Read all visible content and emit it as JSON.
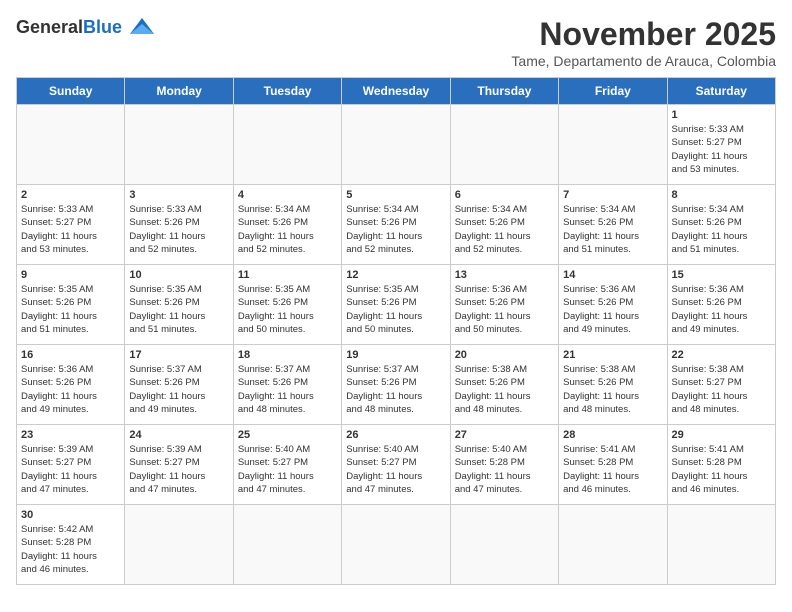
{
  "header": {
    "logo_general": "General",
    "logo_blue": "Blue",
    "month_title": "November 2025",
    "location": "Tame, Departamento de Arauca, Colombia"
  },
  "days_of_week": [
    "Sunday",
    "Monday",
    "Tuesday",
    "Wednesday",
    "Thursday",
    "Friday",
    "Saturday"
  ],
  "weeks": [
    [
      {
        "day": "",
        "info": ""
      },
      {
        "day": "",
        "info": ""
      },
      {
        "day": "",
        "info": ""
      },
      {
        "day": "",
        "info": ""
      },
      {
        "day": "",
        "info": ""
      },
      {
        "day": "",
        "info": ""
      },
      {
        "day": "1",
        "info": "Sunrise: 5:33 AM\nSunset: 5:27 PM\nDaylight: 11 hours\nand 53 minutes."
      }
    ],
    [
      {
        "day": "2",
        "info": "Sunrise: 5:33 AM\nSunset: 5:27 PM\nDaylight: 11 hours\nand 53 minutes."
      },
      {
        "day": "3",
        "info": "Sunrise: 5:33 AM\nSunset: 5:26 PM\nDaylight: 11 hours\nand 52 minutes."
      },
      {
        "day": "4",
        "info": "Sunrise: 5:34 AM\nSunset: 5:26 PM\nDaylight: 11 hours\nand 52 minutes."
      },
      {
        "day": "5",
        "info": "Sunrise: 5:34 AM\nSunset: 5:26 PM\nDaylight: 11 hours\nand 52 minutes."
      },
      {
        "day": "6",
        "info": "Sunrise: 5:34 AM\nSunset: 5:26 PM\nDaylight: 11 hours\nand 52 minutes."
      },
      {
        "day": "7",
        "info": "Sunrise: 5:34 AM\nSunset: 5:26 PM\nDaylight: 11 hours\nand 51 minutes."
      },
      {
        "day": "8",
        "info": "Sunrise: 5:34 AM\nSunset: 5:26 PM\nDaylight: 11 hours\nand 51 minutes."
      }
    ],
    [
      {
        "day": "9",
        "info": "Sunrise: 5:35 AM\nSunset: 5:26 PM\nDaylight: 11 hours\nand 51 minutes."
      },
      {
        "day": "10",
        "info": "Sunrise: 5:35 AM\nSunset: 5:26 PM\nDaylight: 11 hours\nand 51 minutes."
      },
      {
        "day": "11",
        "info": "Sunrise: 5:35 AM\nSunset: 5:26 PM\nDaylight: 11 hours\nand 50 minutes."
      },
      {
        "day": "12",
        "info": "Sunrise: 5:35 AM\nSunset: 5:26 PM\nDaylight: 11 hours\nand 50 minutes."
      },
      {
        "day": "13",
        "info": "Sunrise: 5:36 AM\nSunset: 5:26 PM\nDaylight: 11 hours\nand 50 minutes."
      },
      {
        "day": "14",
        "info": "Sunrise: 5:36 AM\nSunset: 5:26 PM\nDaylight: 11 hours\nand 49 minutes."
      },
      {
        "day": "15",
        "info": "Sunrise: 5:36 AM\nSunset: 5:26 PM\nDaylight: 11 hours\nand 49 minutes."
      }
    ],
    [
      {
        "day": "16",
        "info": "Sunrise: 5:36 AM\nSunset: 5:26 PM\nDaylight: 11 hours\nand 49 minutes."
      },
      {
        "day": "17",
        "info": "Sunrise: 5:37 AM\nSunset: 5:26 PM\nDaylight: 11 hours\nand 49 minutes."
      },
      {
        "day": "18",
        "info": "Sunrise: 5:37 AM\nSunset: 5:26 PM\nDaylight: 11 hours\nand 48 minutes."
      },
      {
        "day": "19",
        "info": "Sunrise: 5:37 AM\nSunset: 5:26 PM\nDaylight: 11 hours\nand 48 minutes."
      },
      {
        "day": "20",
        "info": "Sunrise: 5:38 AM\nSunset: 5:26 PM\nDaylight: 11 hours\nand 48 minutes."
      },
      {
        "day": "21",
        "info": "Sunrise: 5:38 AM\nSunset: 5:26 PM\nDaylight: 11 hours\nand 48 minutes."
      },
      {
        "day": "22",
        "info": "Sunrise: 5:38 AM\nSunset: 5:27 PM\nDaylight: 11 hours\nand 48 minutes."
      }
    ],
    [
      {
        "day": "23",
        "info": "Sunrise: 5:39 AM\nSunset: 5:27 PM\nDaylight: 11 hours\nand 47 minutes."
      },
      {
        "day": "24",
        "info": "Sunrise: 5:39 AM\nSunset: 5:27 PM\nDaylight: 11 hours\nand 47 minutes."
      },
      {
        "day": "25",
        "info": "Sunrise: 5:40 AM\nSunset: 5:27 PM\nDaylight: 11 hours\nand 47 minutes."
      },
      {
        "day": "26",
        "info": "Sunrise: 5:40 AM\nSunset: 5:27 PM\nDaylight: 11 hours\nand 47 minutes."
      },
      {
        "day": "27",
        "info": "Sunrise: 5:40 AM\nSunset: 5:28 PM\nDaylight: 11 hours\nand 47 minutes."
      },
      {
        "day": "28",
        "info": "Sunrise: 5:41 AM\nSunset: 5:28 PM\nDaylight: 11 hours\nand 46 minutes."
      },
      {
        "day": "29",
        "info": "Sunrise: 5:41 AM\nSunset: 5:28 PM\nDaylight: 11 hours\nand 46 minutes."
      }
    ],
    [
      {
        "day": "30",
        "info": "Sunrise: 5:42 AM\nSunset: 5:28 PM\nDaylight: 11 hours\nand 46 minutes."
      },
      {
        "day": "",
        "info": ""
      },
      {
        "day": "",
        "info": ""
      },
      {
        "day": "",
        "info": ""
      },
      {
        "day": "",
        "info": ""
      },
      {
        "day": "",
        "info": ""
      },
      {
        "day": "",
        "info": ""
      }
    ]
  ]
}
